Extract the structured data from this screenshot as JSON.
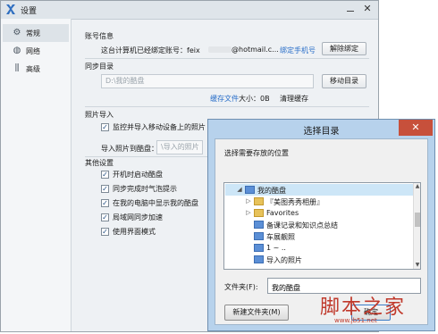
{
  "settings": {
    "title": "设置",
    "sidebar": [
      {
        "label": "常规",
        "icon": "gear-icon",
        "active": true
      },
      {
        "label": "网络",
        "icon": "globe-icon",
        "active": false
      },
      {
        "label": "高级",
        "icon": "sliders-icon",
        "active": false
      }
    ],
    "account": {
      "section_title": "账号信息",
      "bound_prefix": "这台计算机已经绑定账号：feix",
      "bound_suffix": "@hotmail.c...",
      "bind_phone_link": "绑定手机号",
      "unbind_button": "解除绑定"
    },
    "sync": {
      "section_title": "同步目录",
      "path": "D:\\我的酷盘",
      "move_button": "移动目录",
      "cache_link": "缓存文件",
      "cache_size": "大小：0B",
      "clear_cache": "清理缓存"
    },
    "photo": {
      "section_title": "照片导入",
      "monitor_label": "监控并导入移动设备上的照片",
      "import_to_label": "导入照片到酷盘：",
      "import_path_placeholder": "\\导入的照片"
    },
    "other": {
      "section_title": "其他设置",
      "options": [
        {
          "label": "开机时启动酷盘",
          "checked": true
        },
        {
          "label": "同步完成时气泡提示",
          "checked": true
        },
        {
          "label": "在我的电脑中显示我的酷盘",
          "checked": true
        },
        {
          "label": "局域网同步加速",
          "checked": true
        },
        {
          "label": "使用界面模式",
          "checked": true
        }
      ]
    }
  },
  "dialog": {
    "title": "选择目录",
    "close_glyph": "✕",
    "prompt": "选择需要存放的位置",
    "tree": [
      {
        "label": "我的酷盘",
        "level": 0,
        "expanded": true,
        "selected": true,
        "icon": "folder-blue"
      },
      {
        "label": "『美图秀秀相册』",
        "level": 1,
        "expanded": false,
        "icon": "folder-gold"
      },
      {
        "label": "Favorites",
        "level": 1,
        "expanded": false,
        "icon": "folder-gold"
      },
      {
        "label": "备课记录和知识点总结",
        "level": 1,
        "expanded": null,
        "icon": "folder-blue"
      },
      {
        "label": "车展靓照",
        "level": 1,
        "expanded": null,
        "icon": "folder-blue"
      },
      {
        "label": "1 ~ ..",
        "level": 1,
        "expanded": null,
        "icon": "folder-blue"
      },
      {
        "label": "导入的照片",
        "level": 1,
        "expanded": null,
        "icon": "folder-blue"
      }
    ],
    "folder_label": "文件夹(F):",
    "folder_value": "我的酷盘",
    "new_folder_button": "新建文件夹(M)",
    "ok_button": "确定"
  },
  "watermark": {
    "text": "脚本之家",
    "url": "www.jb51.net"
  }
}
